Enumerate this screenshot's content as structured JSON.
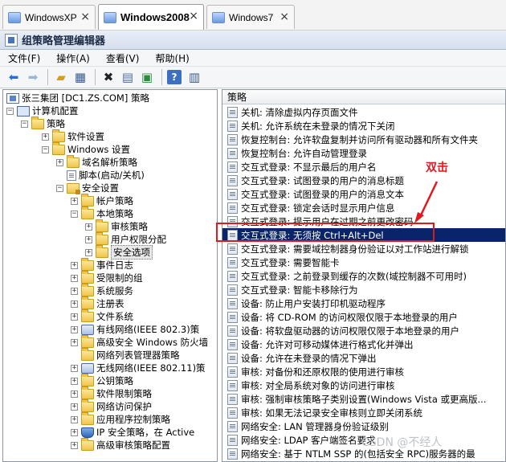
{
  "tabs": [
    {
      "label": "WindowsXP",
      "close": "×"
    },
    {
      "label": "Windows2008",
      "close": "×"
    },
    {
      "label": "Windows7",
      "close": "×"
    }
  ],
  "window": {
    "title": "组策略管理编辑器"
  },
  "menu": {
    "file": "文件(F)",
    "action": "操作(A)",
    "view": "查看(V)",
    "help": "帮助(H)"
  },
  "toolbar": {
    "back_icon": "back-arrow-icon",
    "forward_icon": "forward-arrow-icon",
    "help_glyph": "?"
  },
  "tree": {
    "root": "张三集团 [DC1.ZS.COM] 策略",
    "computer_config": "计算机配置",
    "policies": "策略",
    "software_settings": "软件设置",
    "windows_settings": "Windows 设置",
    "name_resolution": "域名解析策略",
    "scripts": "脚本(启动/关机)",
    "security_settings": "安全设置",
    "account_policies": "帐户策略",
    "local_policies": "本地策略",
    "audit_policy": "审核策略",
    "user_rights": "用户权限分配",
    "security_options": "安全选项",
    "event_log": "事件日志",
    "restricted_groups": "受限制的组",
    "system_services": "系统服务",
    "registry": "注册表",
    "file_system": "文件系统",
    "wired_network": "有线网络(IEEE 802.3)策",
    "advanced_firewall": "高级安全 Windows 防火墙",
    "network_list": "网络列表管理器策略",
    "wireless_network": "无线网络(IEEE 802.11)策",
    "public_key": "公钥策略",
    "software_restriction": "软件限制策略",
    "nap": "网络访问保护",
    "app_control": "应用程序控制策略",
    "ipsec": "IP 安全策略，在 Active",
    "advanced_audit": "高级审核策略配置"
  },
  "list": {
    "header": "策略",
    "items": [
      "关机: 清除虚拟内存页面文件",
      "关机: 允许系统在未登录的情况下关闭",
      "恢复控制台: 允许软盘复制并访问所有驱动器和所有文件夹",
      "恢复控制台: 允许自动管理登录",
      "交互式登录: 不显示最后的用户名",
      "交互式登录: 试图登录的用户的消息标题",
      "交互式登录: 试图登录的用户的消息文本",
      "交互式登录: 锁定会话时显示用户信息",
      "交互式登录: 提示用户在过期之前更改密码",
      "交互式登录: 无须按 Ctrl+Alt+Del",
      "交互式登录: 需要域控制器身份验证以对工作站进行解锁",
      "交互式登录: 需要智能卡",
      "交互式登录: 之前登录到缓存的次数(域控制器不可用时)",
      "交互式登录: 智能卡移除行为",
      "设备: 防止用户安装打印机驱动程序",
      "设备: 将 CD-ROM 的访问权限仅限于本地登录的用户",
      "设备: 将软盘驱动器的访问权限仅限于本地登录的用户",
      "设备: 允许对可移动媒体进行格式化并弹出",
      "设备: 允许在未登录的情况下弹出",
      "审核: 对备份和还原权限的使用进行审核",
      "审核: 对全局系统对象的访问进行审核",
      "审核: 强制审核策略子类别设置(Windows Vista 或更高版...",
      "审核: 如果无法记录安全审核则立即关闭系统",
      "网络安全: LAN 管理器身份验证级别",
      "网络安全: LDAP 客户端签名要求",
      "网络安全: 基于 NTLM SSP 的(包括安全 RPC)服务器的最"
    ],
    "selected_index": 9
  },
  "annotation": {
    "text": "双击",
    "color": "#e1191f"
  },
  "watermark": "CSDN @不经人"
}
